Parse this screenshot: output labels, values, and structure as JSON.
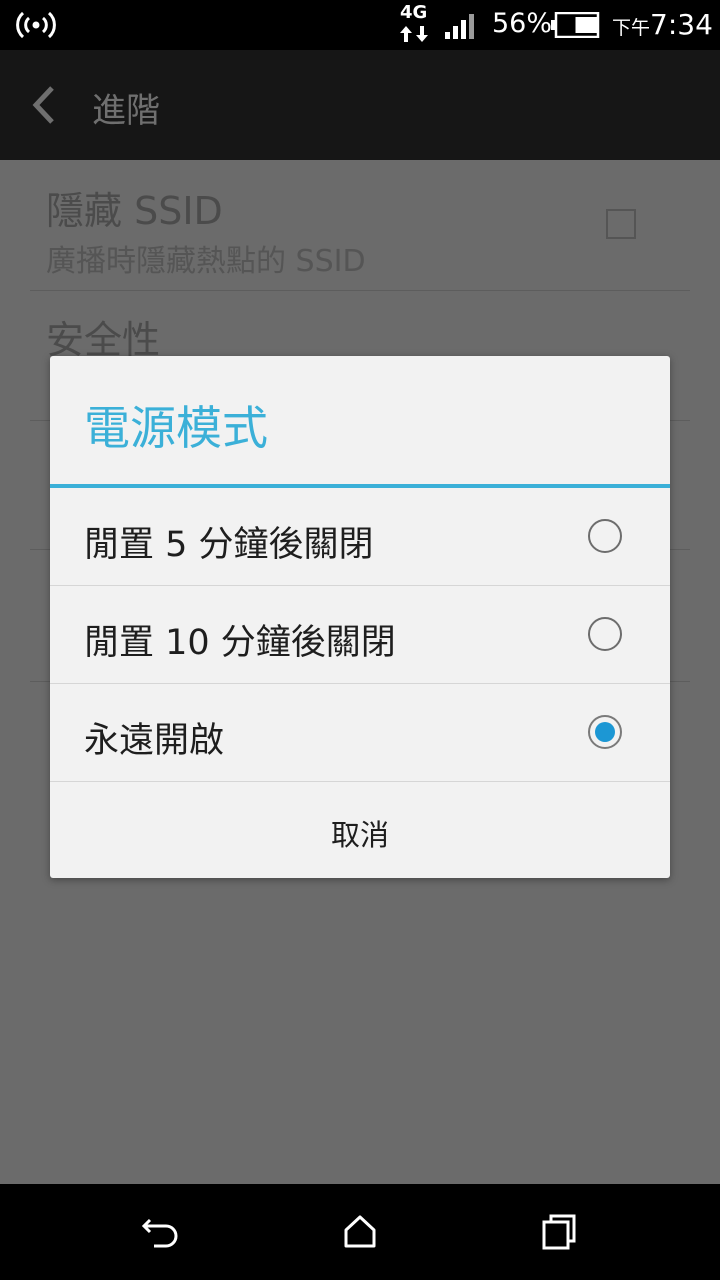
{
  "status_bar": {
    "network_type": "4G",
    "battery_percent": "56%",
    "battery_level": 0.56,
    "ampm": "下午",
    "time": "7:34",
    "icons": [
      "hotspot-icon",
      "data-transfer-icon",
      "signal-icon",
      "battery-icon"
    ]
  },
  "action_bar": {
    "title": "進階",
    "back_icon": "chevron-left-icon"
  },
  "settings": {
    "hidden_ssid_title": "隱藏 SSID",
    "hidden_ssid_summary": "廣播時隱藏熱點的 SSID",
    "hidden_ssid_checked": false,
    "security_title": "安全性"
  },
  "dialog": {
    "title": "電源模式",
    "options": [
      {
        "label": "閒置 5 分鐘後關閉",
        "selected": false
      },
      {
        "label": "閒置 10 分鐘後關閉",
        "selected": false
      },
      {
        "label": "永遠開啟",
        "selected": true
      }
    ],
    "cancel_label": "取消",
    "accent_color": "#3bb0d8"
  },
  "nav_bar": {
    "icons": [
      "back-nav-icon",
      "home-icon",
      "recents-icon"
    ]
  }
}
